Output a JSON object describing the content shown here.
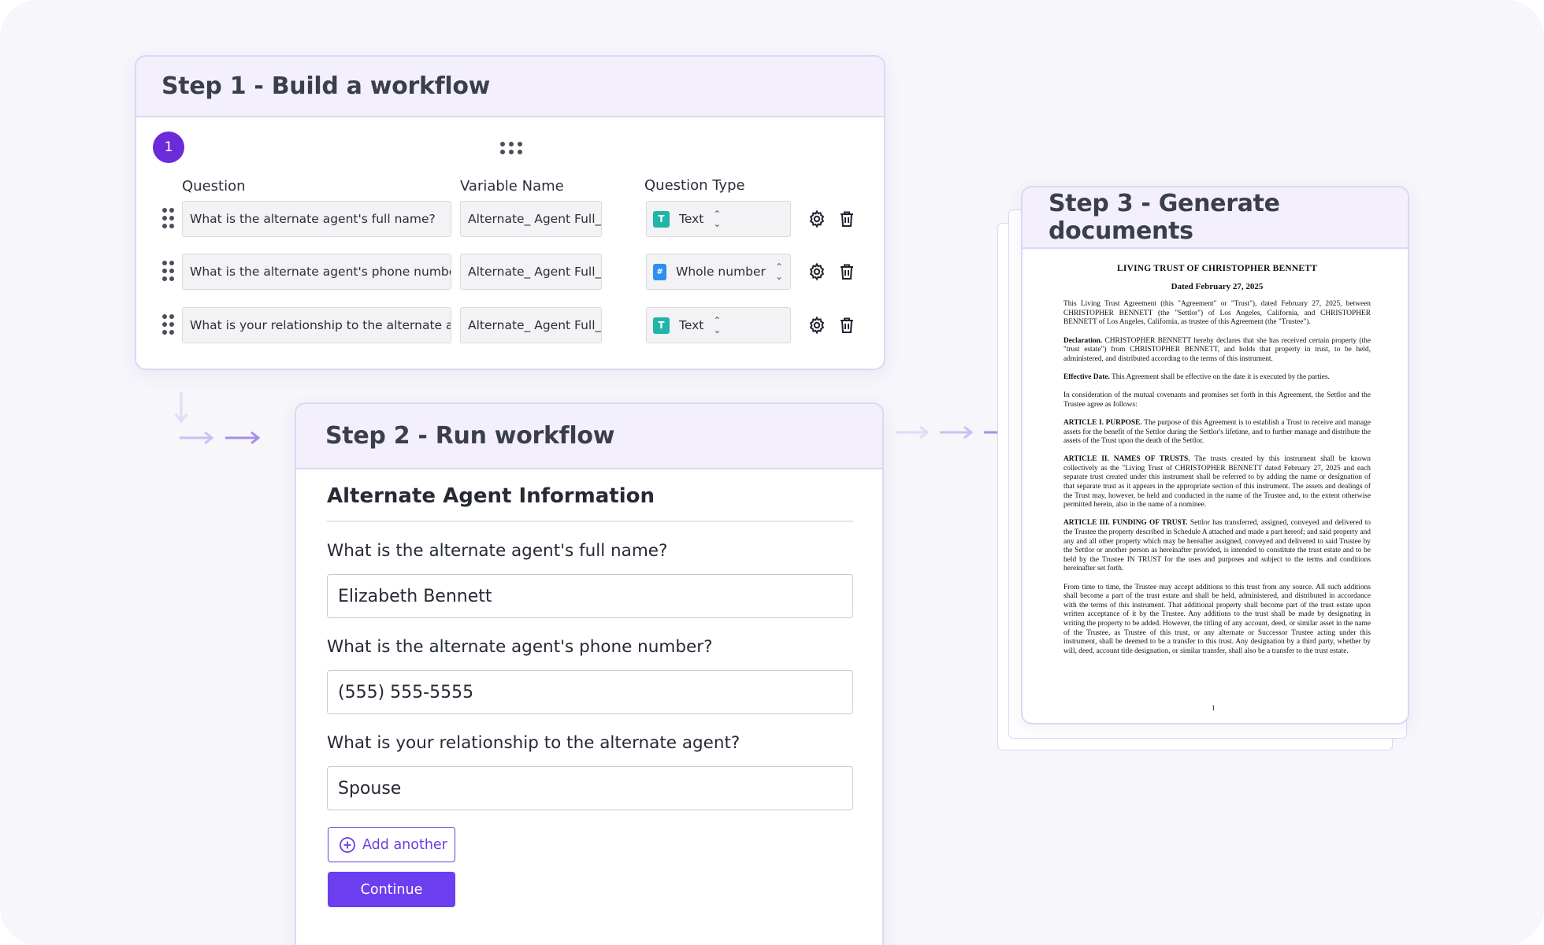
{
  "step1": {
    "title": "Step 1 - Build a workflow",
    "badge": "1",
    "columns": {
      "question": "Question",
      "variable": "Variable Name",
      "type": "Question Type"
    },
    "rows": [
      {
        "question": "What is the alternate agent's full name?",
        "variable": "Alternate_ Agent Full_Name",
        "type": "Text",
        "type_icon": "T"
      },
      {
        "question": "What is the alternate agent's phone number",
        "variable": "Alternate_ Agent Full_Name",
        "type": "Whole number",
        "type_icon": "#"
      },
      {
        "question": "What is your relationship to the alternate age",
        "variable": "Alternate_ Agent Full_Name",
        "type": "Text",
        "type_icon": "T"
      }
    ]
  },
  "step2": {
    "title": "Step 2 - Run workflow",
    "form_title": "Alternate Agent Information",
    "fields": [
      {
        "label": "What is the alternate agent's full name?",
        "value": "Elizabeth Bennett"
      },
      {
        "label": "What is the alternate agent's phone number?",
        "value": "(555) 555-5555"
      },
      {
        "label": "What is your relationship to the alternate agent?",
        "value": "Spouse"
      }
    ],
    "add_label": "Add another",
    "continue_label": "Continue"
  },
  "step3": {
    "title": "Step 3 - Generate documents",
    "doc_title": "LIVING TRUST OF CHRISTOPHER BENNETT",
    "doc_date": "Dated February 27, 2025",
    "paragraphs": [
      {
        "head": "",
        "body": "This Living Trust Agreement (this \"Agreement\" or \"Trust\"), dated February 27, 2025, between CHRISTOPHER BENNETT (the \"Settlor\") of Los Angeles, California, and CHRISTOPHER BENNETT of Los Angeles, California, as trustee of this Agreement (the \"Trustee\")."
      },
      {
        "head": "Declaration.",
        "body": " CHRISTOPHER BENNETT hereby declares that she has received certain property (the \"trust estate\") from CHRISTOPHER BENNETT, and holds that property in trust, to be held, administered, and distributed according to the terms of this instrument."
      },
      {
        "head": "Effective Date.",
        "body": " This Agreement shall be effective on the date it is executed by the parties."
      },
      {
        "head": "",
        "body": "In consideration of the mutual covenants and promises set forth in this Agreement, the Settlor and the Trustee agree as follows:"
      },
      {
        "head": "ARTICLE I. PURPOSE.",
        "body": " The purpose of this Agreement is to establish a Trust to receive and manage assets for the benefit of the Settlor during the Settlor's lifetime, and to further manage and distribute the assets of the Trust upon the death of the Settlor."
      },
      {
        "head": "ARTICLE II. NAMES OF TRUSTS.",
        "body": " The trusts created by this instrument shall be known collectively as the \"Living Trust of CHRISTOPHER BENNETT dated February 27, 2025 and each separate trust created under this instrument shall be referred to by adding the name or designation of that separate trust as it appears in the appropriate section of this instrument. The assets and dealings of the Trust may, however, be held and conducted in the name of the Trustee and, to the extent otherwise permitted herein, also in the name of a nominee."
      },
      {
        "head": "ARTICLE III. FUNDING OF TRUST.",
        "body": " Settlor has transferred, assigned, conveyed and delivered to the Trustee the property described in Schedule A attached and made a part hereof; and said property and any and all other property which may be hereafter assigned, conveyed and delivered to said Trustee by the Settlor or another person as hereinafter provided, is intended to constitute the trust estate and to be held by the Trustee IN TRUST for the uses and purposes and subject to the terms and conditions hereinafter set forth."
      },
      {
        "head": "",
        "body": "From time to time, the Trustee may accept additions to this trust from any source. All such additions shall become a part of the trust estate and shall be held, administered, and distributed in accordance with the terms of this instrument. That additional property shall become part of the trust estate upon written acceptance of it by the Trustee. Any additions to the trust shall be made by designating in writing the property to be added. However, the titling of any account, deed, or similar asset in the name of the Trustee, as Trustee of this trust, or any alternate or Successor Trustee acting under this instrument, shall be deemed to be a transfer to this trust. Any designation by a third party, whether by will, deed, account title designation, or similar transfer, shall also be a transfer to the trust estate."
      }
    ],
    "page_number": "1"
  },
  "colors": {
    "accent": "#6c3ef0",
    "badge": "#6c2bd9",
    "panel_header": "#f3f0fc",
    "text_chip": "#1fb5a9",
    "number_chip": "#2f8ef0"
  }
}
